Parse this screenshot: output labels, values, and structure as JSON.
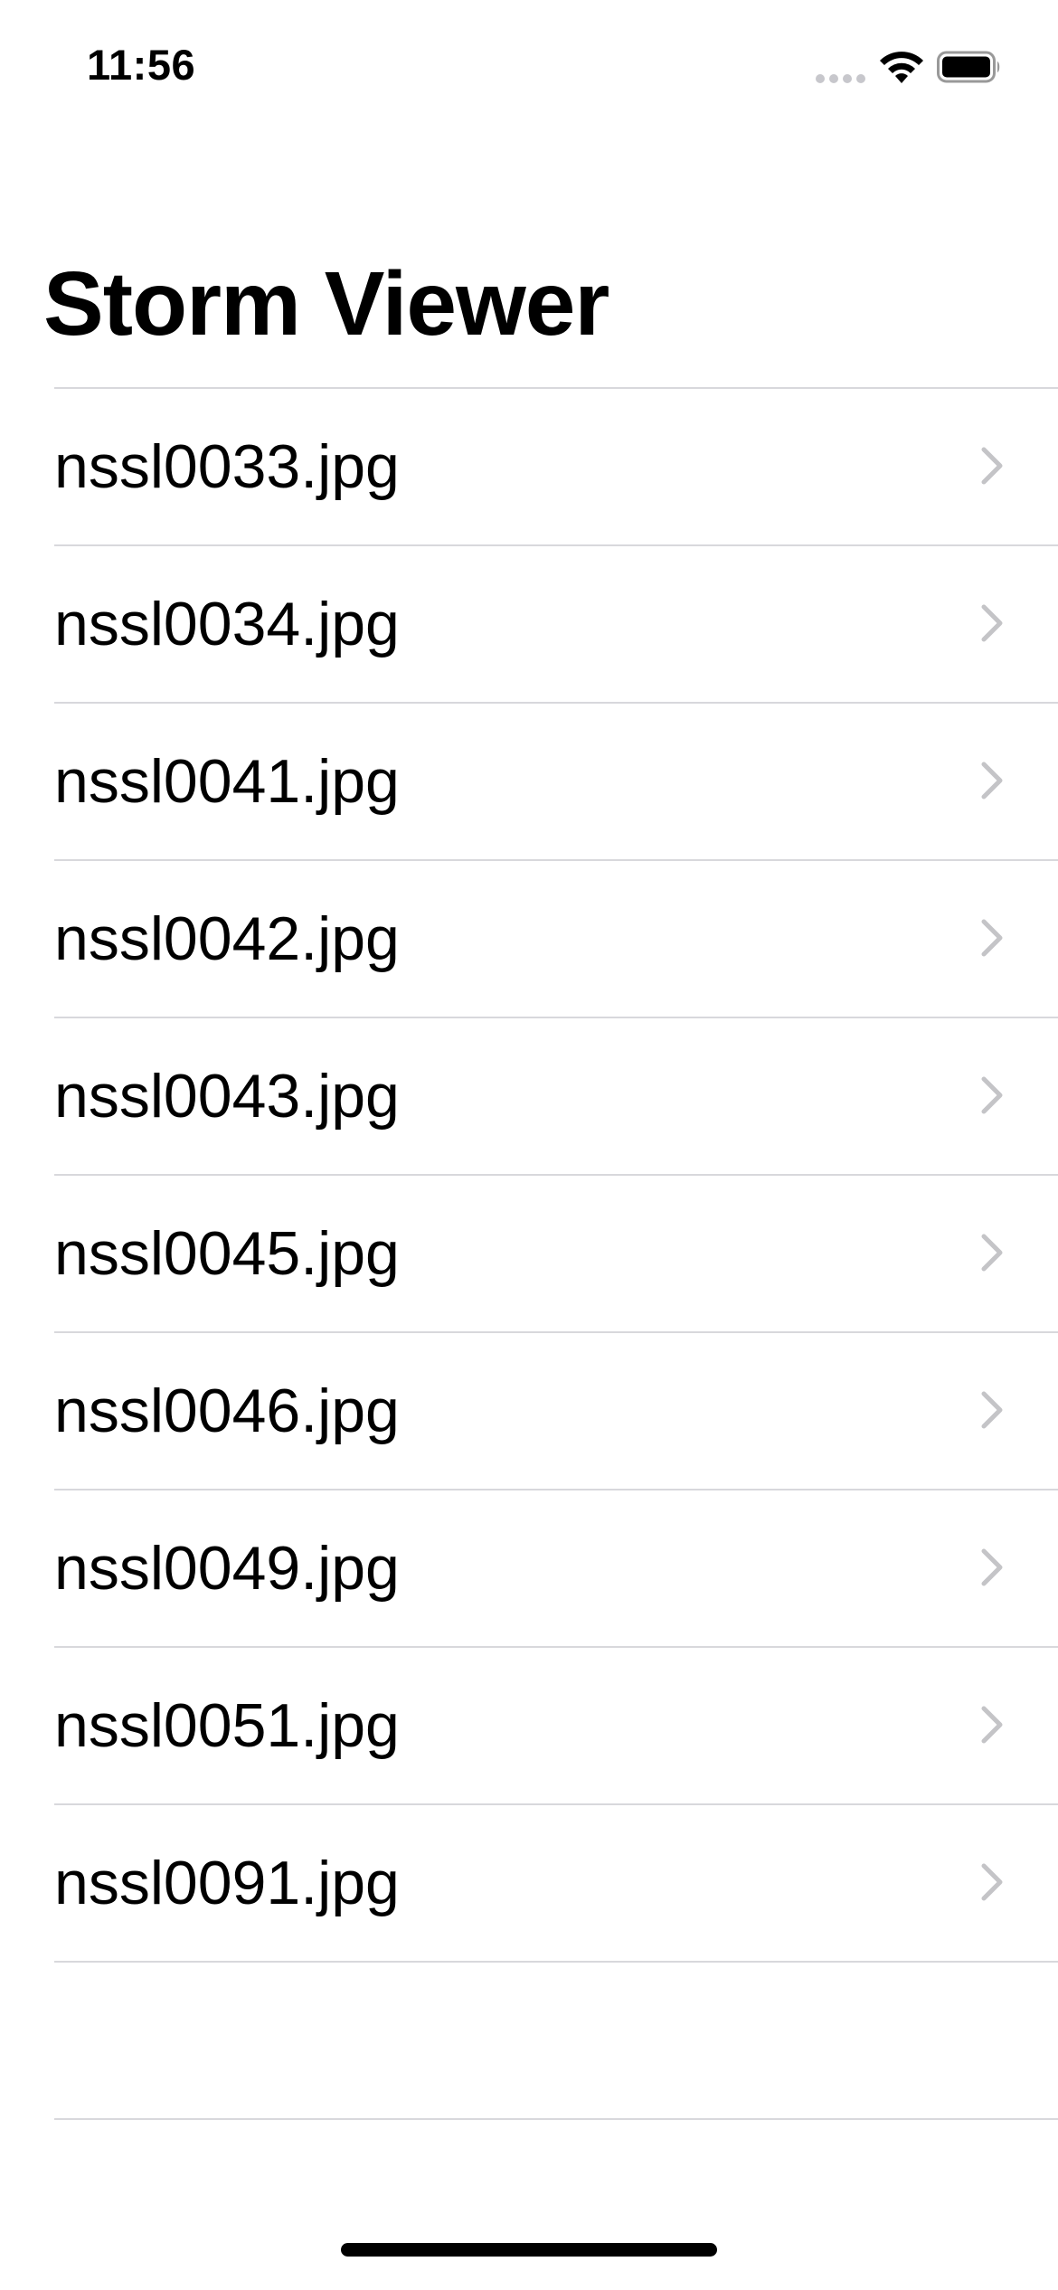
{
  "status_bar": {
    "time": "11:56",
    "signal_icon": "cellular-signal-icon",
    "wifi_icon": "wifi-icon",
    "battery_icon": "battery-full-icon"
  },
  "navigation": {
    "title": "Storm Viewer"
  },
  "table": {
    "rows": [
      {
        "label": "nssl0033.jpg",
        "accessory": "chevron-right-icon"
      },
      {
        "label": "nssl0034.jpg",
        "accessory": "chevron-right-icon"
      },
      {
        "label": "nssl0041.jpg",
        "accessory": "chevron-right-icon"
      },
      {
        "label": "nssl0042.jpg",
        "accessory": "chevron-right-icon"
      },
      {
        "label": "nssl0043.jpg",
        "accessory": "chevron-right-icon"
      },
      {
        "label": "nssl0045.jpg",
        "accessory": "chevron-right-icon"
      },
      {
        "label": "nssl0046.jpg",
        "accessory": "chevron-right-icon"
      },
      {
        "label": "nssl0049.jpg",
        "accessory": "chevron-right-icon"
      },
      {
        "label": "nssl0051.jpg",
        "accessory": "chevron-right-icon"
      },
      {
        "label": "nssl0091.jpg",
        "accessory": "chevron-right-icon"
      }
    ]
  },
  "colors": {
    "background": "#ffffff",
    "text": "#000000",
    "separator": "#d8d8dc",
    "chevron": "#c4c4c7",
    "inactive_signal": "#c7c7cc"
  }
}
